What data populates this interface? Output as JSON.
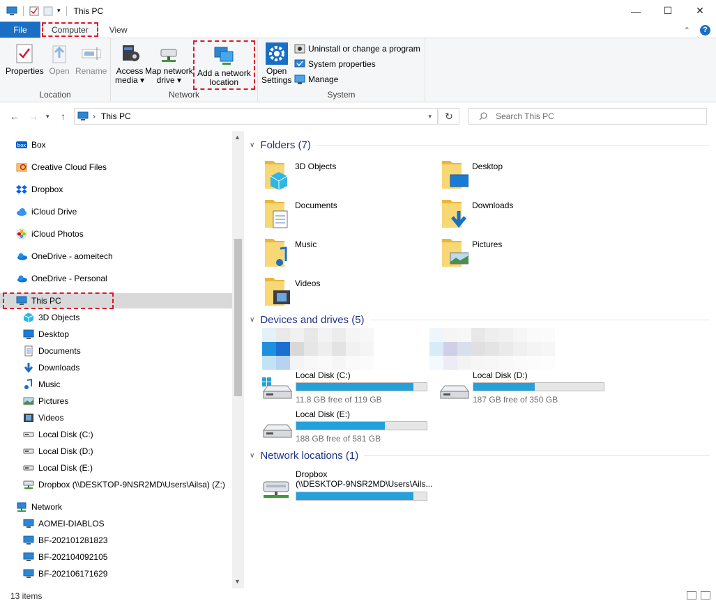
{
  "window": {
    "title": "This PC"
  },
  "ribbon": {
    "tabs": [
      "File",
      "Computer",
      "View"
    ],
    "active_tab": "Computer",
    "groups": {
      "location": {
        "label": "Location",
        "properties": "Properties",
        "open": "Open",
        "rename": "Rename"
      },
      "network": {
        "label": "Network",
        "access_media": [
          "Access",
          "media"
        ],
        "map_network_drive": [
          "Map network",
          "drive"
        ],
        "add_network_location": [
          "Add a network",
          "location"
        ]
      },
      "system": {
        "label": "System",
        "open_settings": [
          "Open",
          "Settings"
        ],
        "uninstall": "Uninstall or change a program",
        "system_properties": "System properties",
        "manage": "Manage"
      }
    }
  },
  "address": {
    "path": "This PC",
    "search_placeholder": "Search This PC"
  },
  "sidebar": {
    "items": [
      {
        "label": "Box",
        "icon": "box-icon"
      },
      {
        "label": "Creative Cloud Files",
        "icon": "creative-cloud-icon"
      },
      {
        "label": "Dropbox",
        "icon": "dropbox-icon"
      },
      {
        "label": "iCloud Drive",
        "icon": "icloud-icon"
      },
      {
        "label": "iCloud Photos",
        "icon": "icloud-photos-icon"
      },
      {
        "label": "OneDrive - aomeitech",
        "icon": "onedrive-icon"
      },
      {
        "label": "OneDrive - Personal",
        "icon": "onedrive-icon"
      },
      {
        "label": "This PC",
        "icon": "computer-icon"
      }
    ],
    "this_pc_children": [
      {
        "label": "3D Objects",
        "icon": "3d-objects-icon"
      },
      {
        "label": "Desktop",
        "icon": "desktop-icon"
      },
      {
        "label": "Documents",
        "icon": "documents-icon"
      },
      {
        "label": "Downloads",
        "icon": "downloads-icon"
      },
      {
        "label": "Music",
        "icon": "music-icon"
      },
      {
        "label": "Pictures",
        "icon": "pictures-icon"
      },
      {
        "label": "Videos",
        "icon": "videos-icon"
      },
      {
        "label": "Local Disk (C:)",
        "icon": "drive-icon"
      },
      {
        "label": "Local Disk (D:)",
        "icon": "drive-icon"
      },
      {
        "label": "Local Disk (E:)",
        "icon": "drive-icon"
      },
      {
        "label": "Dropbox (\\\\DESKTOP-9NSR2MD\\Users\\Ailsa) (Z:)",
        "icon": "network-drive-icon"
      }
    ],
    "network": {
      "label": "Network",
      "icon": "network-icon"
    },
    "network_children": [
      "AOMEI-DIABLOS",
      "BF-202101281823",
      "BF-202104092105",
      "BF-202106171629"
    ]
  },
  "content": {
    "folders_header": "Folders (7)",
    "folders": [
      "3D Objects",
      "Desktop",
      "Documents",
      "Downloads",
      "Music",
      "Pictures",
      "Videos"
    ],
    "devices_header": "Devices and drives (5)",
    "drives": [
      {
        "name": "Local Disk (C:)",
        "free": "11.8 GB free of 119 GB",
        "used_fraction": 0.9
      },
      {
        "name": "Local Disk (D:)",
        "free": "187 GB free of 350 GB",
        "used_fraction": 0.47
      },
      {
        "name": "Local Disk (E:)",
        "free": "188 GB free of 581 GB",
        "used_fraction": 0.68
      }
    ],
    "network_header": "Network locations (1)",
    "network_locations": [
      {
        "name": "Dropbox",
        "path": "(\\\\DESKTOP-9NSR2MD\\Users\\Ails...",
        "used_fraction": 0.9
      }
    ]
  },
  "status": {
    "items_count": "13 items"
  },
  "colors": {
    "accent": "#1a6fc4",
    "highlight": "#e0152a",
    "section_text": "#1e3287",
    "drive_bar": "#26a0da"
  }
}
